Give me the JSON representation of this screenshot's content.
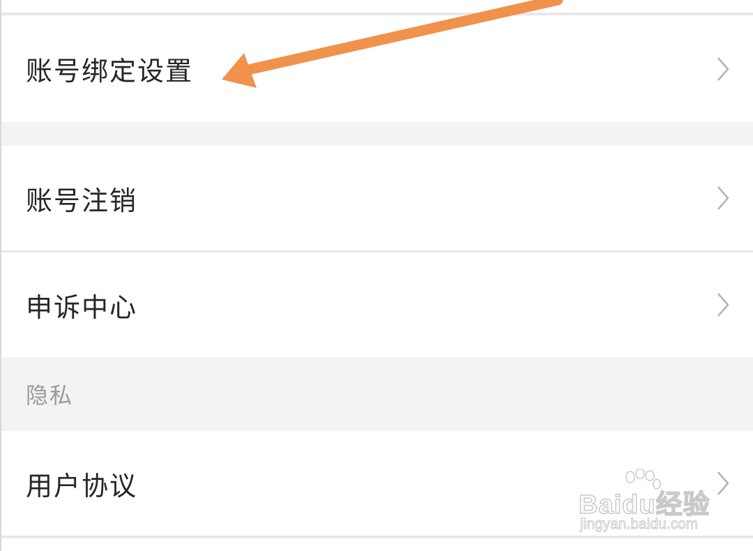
{
  "settings": {
    "items": [
      {
        "label": "账号绑定设置",
        "chevron": "chevron-right-icon"
      },
      {
        "label": "账号注销",
        "chevron": "chevron-right-icon"
      },
      {
        "label": "申诉中心",
        "chevron": "chevron-right-icon"
      },
      {
        "label": "用户协议",
        "chevron": "chevron-right-icon"
      }
    ],
    "section_privacy": "隐私"
  },
  "annotation": {
    "arrow_color": "#f0924c",
    "icon": "arrow-pointer-icon"
  },
  "watermark": {
    "brand": "Baidu经验",
    "url": "jingyan.baidu.com"
  },
  "colors": {
    "background": "#f5f5f5",
    "row_background": "#ffffff",
    "text": "#262626",
    "section_text": "#9a9a9a",
    "chevron": "#b3b3b3"
  }
}
